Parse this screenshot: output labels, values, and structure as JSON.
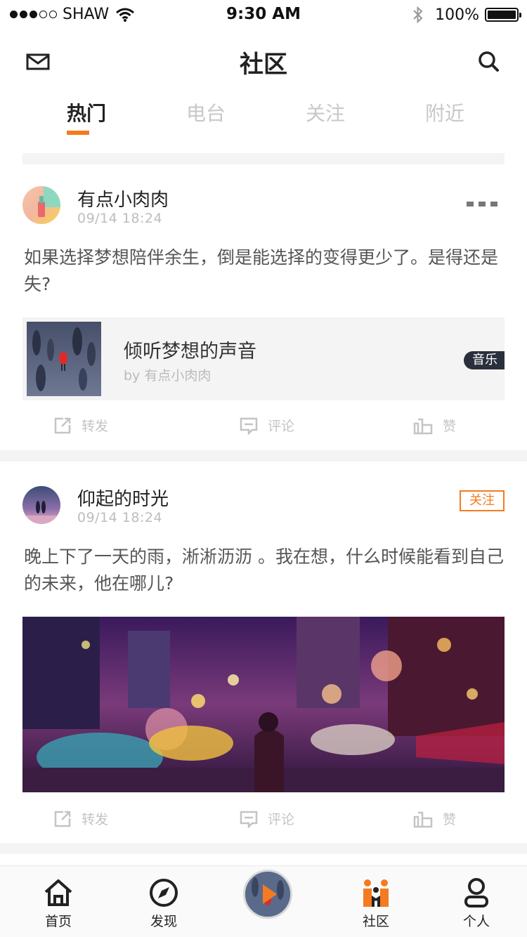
{
  "status_bar": {
    "carrier": "SHAW",
    "time": "9:30 AM",
    "battery": "100%"
  },
  "nav": {
    "title": "社区",
    "left_icon": "mail-icon",
    "right_icon": "search-icon"
  },
  "tabs": [
    {
      "label": "热门",
      "active": true
    },
    {
      "label": "电台",
      "active": false
    },
    {
      "label": "关注",
      "active": false
    },
    {
      "label": "附近",
      "active": false
    }
  ],
  "posts": [
    {
      "user": "有点小肉肉",
      "time": "09/14  18:24",
      "text": "如果选择梦想陪伴余生，倒是能选择的变得更少了。是得还是失?",
      "share": {
        "title": "倾听梦想的声音",
        "by": "by 有点小肉肉",
        "tag": "音乐"
      },
      "actions": {
        "forward": "转发",
        "comment": "评论",
        "like": "赞"
      }
    },
    {
      "user": "仰起的时光",
      "time": "09/14  18:24",
      "follow_label": "关注",
      "text": "晚上下了一天的雨，淅淅沥沥 。我在想，什么时候能看到自己的未来，他在哪儿?",
      "actions": {
        "forward": "转发",
        "comment": "评论",
        "like": "赞"
      }
    }
  ],
  "tabbar": [
    {
      "label": "首页",
      "icon": "home-icon"
    },
    {
      "label": "发现",
      "icon": "compass-icon"
    },
    {
      "label": "社区",
      "icon": "community-icon"
    },
    {
      "label": "个人",
      "icon": "person-icon"
    }
  ],
  "colors": {
    "accent": "#f47b20",
    "tag_bg": "#2a2f3c",
    "separator": "#f4f4f4"
  }
}
